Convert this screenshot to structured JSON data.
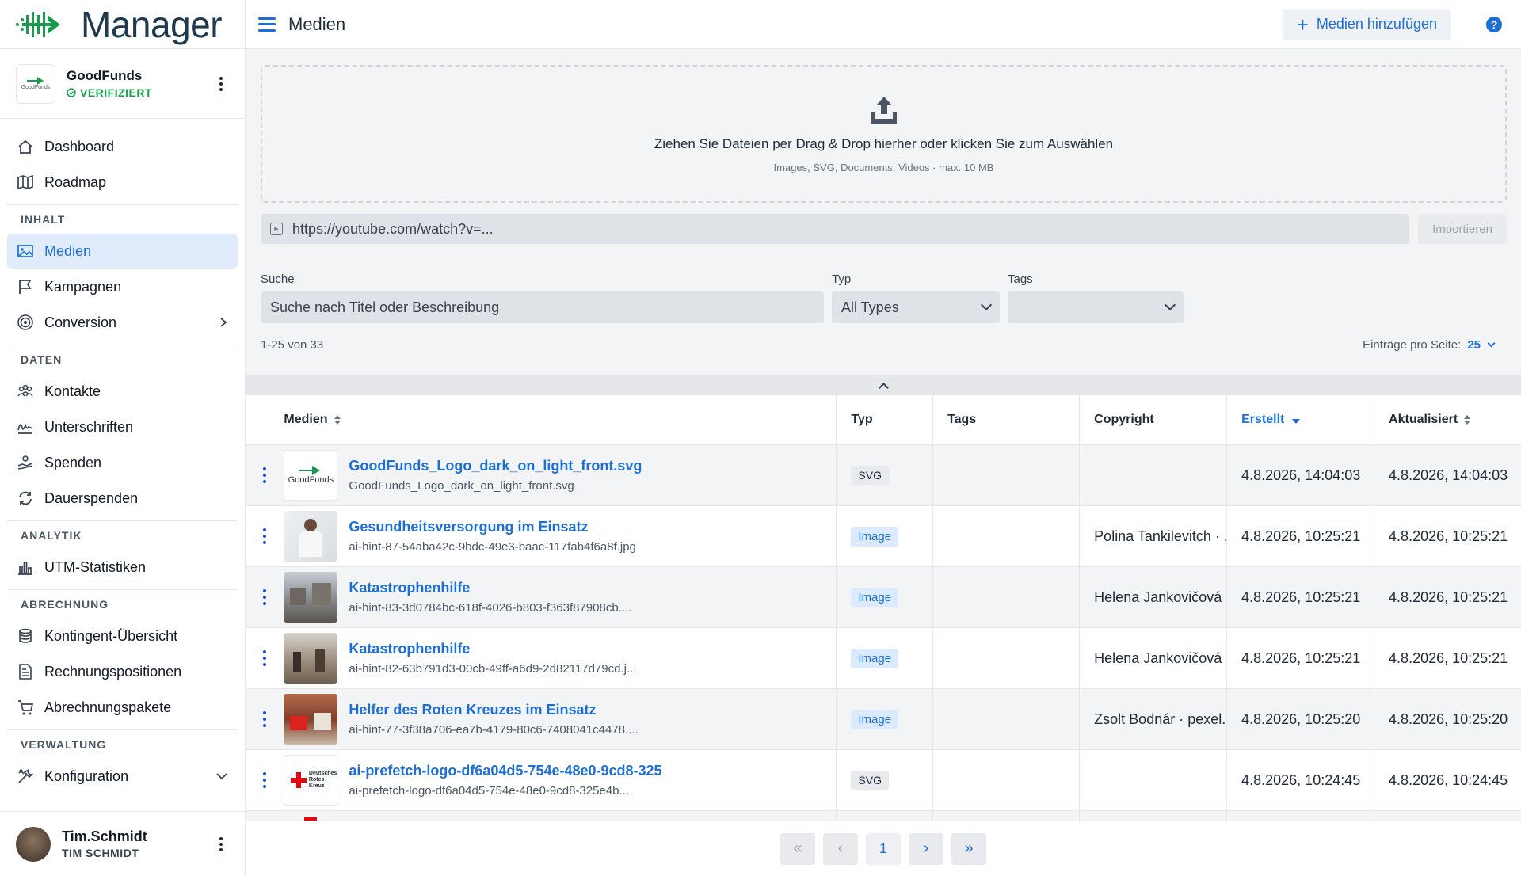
{
  "app": {
    "logo_text": "Manager"
  },
  "org": {
    "name": "GoodFunds",
    "status": "VERIFIZIERT",
    "thumb_text": "GoodFunds"
  },
  "sidebar": {
    "top": [
      {
        "label": "Dashboard",
        "icon": "home-icon"
      },
      {
        "label": "Roadmap",
        "icon": "map-icon"
      }
    ],
    "sections": [
      {
        "title": "INHALT",
        "items": [
          {
            "label": "Medien",
            "icon": "image-icon",
            "active": true
          },
          {
            "label": "Kampagnen",
            "icon": "flag-icon"
          },
          {
            "label": "Conversion",
            "icon": "target-icon",
            "chevron": "right"
          }
        ]
      },
      {
        "title": "DATEN",
        "items": [
          {
            "label": "Kontakte",
            "icon": "users-icon"
          },
          {
            "label": "Unterschriften",
            "icon": "signature-icon"
          },
          {
            "label": "Spenden",
            "icon": "donation-icon"
          },
          {
            "label": "Dauerspenden",
            "icon": "repeat-icon"
          }
        ]
      },
      {
        "title": "ANALYTIK",
        "items": [
          {
            "label": "UTM-Statistiken",
            "icon": "bar-chart-icon"
          }
        ]
      },
      {
        "title": "ABRECHNUNG",
        "items": [
          {
            "label": "Kontingent-Übersicht",
            "icon": "coins-icon"
          },
          {
            "label": "Rechnungspositionen",
            "icon": "invoice-icon"
          },
          {
            "label": "Abrechnungspakete",
            "icon": "cart-icon"
          }
        ]
      },
      {
        "title": "VERWALTUNG",
        "items": [
          {
            "label": "Konfiguration",
            "icon": "tools-icon",
            "chevron": "down"
          }
        ]
      }
    ]
  },
  "user": {
    "name": "Tim.Schmidt",
    "fullname": "TIM SCHMIDT"
  },
  "header": {
    "title": "Medien",
    "add_label": "Medien hinzufügen",
    "help": "?"
  },
  "dropzone": {
    "main": "Ziehen Sie Dateien per Drag & Drop hierher oder klicken Sie zum Auswählen",
    "sub": "Images, SVG, Documents, Videos · max. 10 MB"
  },
  "url_import": {
    "value": "https://youtube.com/watch?v=...",
    "button": "Importieren"
  },
  "filters": {
    "search_label": "Suche",
    "search_placeholder": "Suche nach Titel oder Beschreibung",
    "type_label": "Typ",
    "type_value": "All Types",
    "tags_label": "Tags",
    "tags_value": ""
  },
  "listing": {
    "count": "1-25 von 33",
    "per_page_label": "Einträge pro Seite:",
    "per_page_value": "25"
  },
  "table": {
    "headers": [
      "Medien",
      "Typ",
      "Tags",
      "Copyright",
      "Erstellt",
      "Aktualisiert"
    ],
    "rows": [
      {
        "title": "GoodFunds_Logo_dark_on_light_front.svg",
        "sub": "GoodFunds_Logo_dark_on_light_front.svg",
        "type": "SVG",
        "tags": "",
        "copyright": "",
        "created": "4.8.2026, 14:04:03",
        "updated": "4.8.2026, 14:04:03",
        "thumb": "logo",
        "thumb_text": "GoodFunds"
      },
      {
        "title": "Gesundheitsversorgung im Einsatz",
        "sub": "ai-hint-87-54aba42c-9bdc-49e3-baac-117fab4f6a8f.jpg",
        "type": "Image",
        "tags": "",
        "copyright": "Polina Tankilevitch · ...",
        "created": "4.8.2026, 10:25:21",
        "updated": "4.8.2026, 10:25:21",
        "thumb": "photo1",
        "thumb_text": ""
      },
      {
        "title": "Katastrophenhilfe",
        "sub": "ai-hint-83-3d0784bc-618f-4026-b803-f363f87908cb....",
        "type": "Image",
        "tags": "",
        "copyright": "Helena Jankovičová ...",
        "created": "4.8.2026, 10:25:21",
        "updated": "4.8.2026, 10:25:21",
        "thumb": "photo2",
        "thumb_text": ""
      },
      {
        "title": "Katastrophenhilfe",
        "sub": "ai-hint-82-63b791d3-00cb-49ff-a6d9-2d82117d79cd.j...",
        "type": "Image",
        "tags": "",
        "copyright": "Helena Jankovičová ...",
        "created": "4.8.2026, 10:25:21",
        "updated": "4.8.2026, 10:25:21",
        "thumb": "photo3",
        "thumb_text": ""
      },
      {
        "title": "Helfer des Roten Kreuzes im Einsatz",
        "sub": "ai-hint-77-3f38a706-ea7b-4179-80c6-7408041c4478....",
        "type": "Image",
        "tags": "",
        "copyright": "Zsolt Bodnár · pexel...",
        "created": "4.8.2026, 10:25:20",
        "updated": "4.8.2026, 10:25:20",
        "thumb": "photo4",
        "thumb_text": ""
      },
      {
        "title": "ai-prefetch-logo-df6a04d5-754e-48e0-9cd8-325",
        "sub": "ai-prefetch-logo-df6a04d5-754e-48e0-9cd8-325e4b...",
        "type": "SVG",
        "tags": "",
        "copyright": "",
        "created": "4.8.2026, 10:24:45",
        "updated": "4.8.2026, 10:24:45",
        "thumb": "redcross",
        "thumb_text": "Deutsches Rotes Kreuz"
      }
    ]
  },
  "pagination": {
    "current": "1"
  },
  "colors": {
    "accent": "#1d6fd8",
    "verified": "#16a34a"
  }
}
